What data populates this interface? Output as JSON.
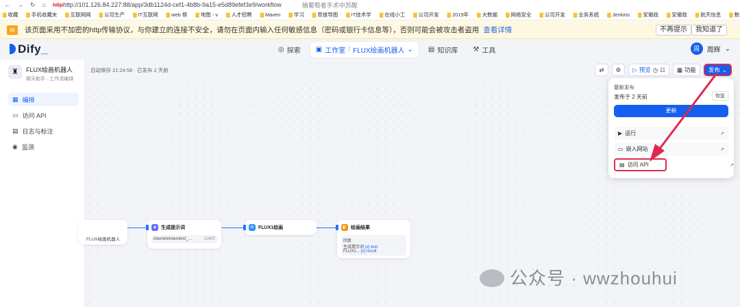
{
  "browser": {
    "url": "http://101.126.84.227:88/app/3db1124d-cef1-4b8b-9a15-e5d89efef3e9/workflow",
    "search_placeholder": "摘葡萄者手术中苏醒",
    "bookmarks": [
      "收藏",
      "手机收藏夹",
      "互联网网",
      "公司生产",
      "IT互联网",
      "web 框",
      "地图 - v",
      "人才招聘",
      "Maven",
      "学习",
      "思维导图",
      "IT技术学",
      "在线小工",
      "公司开发",
      "2019年",
      "大数据",
      "网络安全",
      "公司开发",
      "业务系统",
      "Jenkins",
      "安徽政",
      "安徽政",
      "航天信息",
      "数优网"
    ]
  },
  "warning": {
    "text": "该页面采用不加密的http传输协议，与你建立的连接不安全，请勿在页面内输入任何敏感信息（密码或银行卡信息等），否则可能会被攻击者盗用",
    "link": "查看详情",
    "btn1": "不再提示",
    "btn2": "我知道了"
  },
  "header": {
    "logo": "Dify",
    "nav": {
      "explore": "探索",
      "studio": "工作室",
      "app": "FLUX绘画机器人",
      "knowledge": "知识库",
      "tools": "工具"
    },
    "user_avatar": "周",
    "user_name": "周辉"
  },
  "sidebar": {
    "app_name": "FLUX绘画机器人",
    "app_sub": "聊天助手 · 工作流编排",
    "items": [
      {
        "label": "编排"
      },
      {
        "label": "访问 API"
      },
      {
        "label": "日志与标注"
      },
      {
        "label": "监测"
      }
    ]
  },
  "toolbar": {
    "saved": "自动保存 21:24:58 · 已发布 2 天前",
    "preview": "预览",
    "features": "功能",
    "publish": "发布"
  },
  "popover": {
    "latest": "最新发布",
    "published": "发布于 2 天前",
    "restore": "恢复",
    "update": "更新",
    "rows": [
      {
        "label": "运行"
      },
      {
        "label": "嵌入网站"
      },
      {
        "label": "访问 API"
      }
    ]
  },
  "nodes": {
    "start_text": "FLUX绘画机器人",
    "n1_title": "生成提示词",
    "n1_model": "internlm/internlm2_...",
    "n1_tag": "CHAT",
    "n2_title": "FLUX1绘画",
    "n3_title": "绘画结果",
    "n3_label": "回复",
    "n3_v1": "生成提示词",
    "n3_v1t": "{x} text",
    "n3_v2": "FLUX1...",
    "n3_v2t": "{x} result"
  },
  "watermark": "公众号 · wwzhouhui",
  "colors": {
    "accent": "#155eef",
    "highlight": "#e0284d",
    "warning_bg": "#fff8e1"
  }
}
